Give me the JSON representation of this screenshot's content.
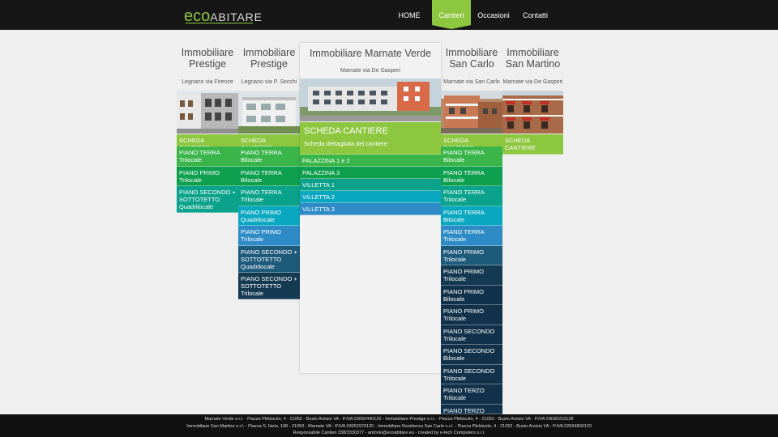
{
  "logo": {
    "eco": "eco",
    "abitare": "ABITARE"
  },
  "nav": {
    "home": "HOME",
    "cantieri": "Cantieri",
    "occasioni": "Occasioni",
    "contatti": "Contatti"
  },
  "cols": [
    {
      "title": "Immobiliare Prestige",
      "subtitle": "Legnano via Firenze",
      "items": [
        "SCHEDA CANTIERE",
        "PIANO TERRA Trilocale",
        "PIANO PRIMO Trilocale",
        "PIANO SECONDO + SOTTOTETTO Quadrilocale"
      ]
    },
    {
      "title": "Immobiliare Prestige",
      "subtitle": "Legnano via P. Secchi",
      "items": [
        "SCHEDA CANTIERE",
        "PIANO TERRA Bilocale",
        "PIANO TERRA Bilocale",
        "PIANO TERRA Trilocale",
        "PIANO PRIMO Quadrilocale",
        "PIANO PRIMO Trilocale",
        "PIANO SECONDO + SOTTOTETTO Quadrilocale",
        "PIANO SECONDO + SOTTOTETTO Trilocale"
      ]
    },
    {
      "title": "Immobiliare Marnate Verde",
      "subtitle": "Marnate via De Gasperi",
      "scheda_title": "SCHEDA CANTIERE",
      "scheda_sub": "Scheda dettagliata del cantiere",
      "items": [
        "PALAZZINA 1 e 2",
        "PALAZZINA 3",
        "VILLETTA 1",
        "VILLETTA 2",
        "VILLETTA 3"
      ]
    },
    {
      "title": "Immobiliare San Carlo",
      "subtitle": "Marnate via San Carlo",
      "items": [
        "SCHEDA CANTIERE",
        "PIANO TERRA Bilocale",
        "PIANO TERRA Bilocale",
        "PIANO TERRA Trilocale",
        "PIANO TERRA Bilocale",
        "PIANO TERRA Trilocale",
        "PIANO PRIMO Trilocale",
        "PIANO PRIMO Trilocale",
        "PIANO PRIMO Bilocale",
        "PIANO PRIMO Trilocale",
        "PIANO SECONDO Trilocale",
        "PIANO SECONDO Bilocale",
        "PIANO SECONDO Trilocale",
        "PIANO TERZO Trilocale",
        "PIANO TERZO"
      ]
    },
    {
      "title": "Immobiliare San Martino",
      "subtitle": "Marnate via De Gasperi",
      "items": [
        "SCHEDA CANTIERE"
      ]
    }
  ],
  "footer": {
    "line1": "Marnate Verde s.r.l. - Piazza Plebiscito, 4 - 21052 - Busto Arsizio VA - P.IVA 03092440125 - Immobiliare Prestige s.r.l. - Piazza Plebiscito, 4 - 21052 - Busto Arsizio VA - P.IVA 03030210128",
    "line2": "Immobiliare San Martino s.r.l. - Piazza S. Ilario, 108 - 21050 - Marnate VA - P.IVA 03052970120 - Immobiliare Residenza San Carlo s.r.l. - Piazza Plebiscito, 4 - 21052 - Busto Arsizio VA - P.IVA 02934800123",
    "line3": "Responsabile Cantieri 338/3330377 - antonio@ecoabitare.eu - created by e-tech Computers s.r.l."
  }
}
